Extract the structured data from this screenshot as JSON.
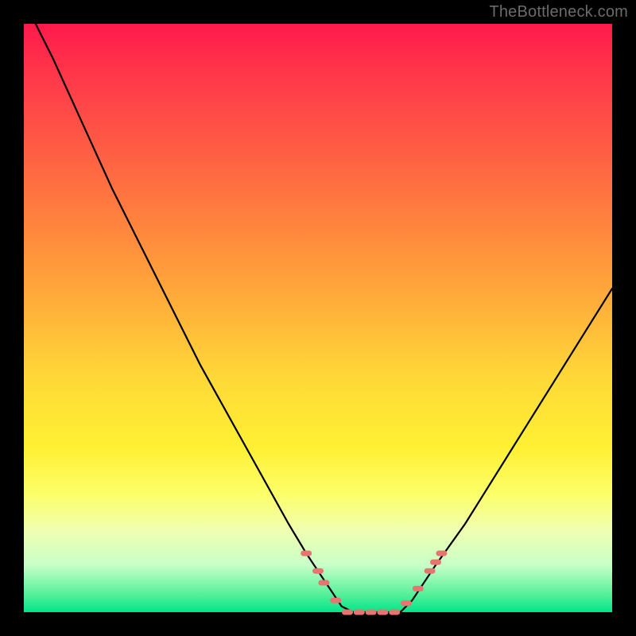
{
  "attribution": "TheBottleneck.com",
  "colors": {
    "frame": "#000000",
    "gradient_top": "#ff1a4b",
    "gradient_bottom": "#00e58a",
    "curve": "#000000",
    "marker": "#e6746f"
  },
  "chart_data": {
    "type": "line",
    "title": "",
    "xlabel": "",
    "ylabel": "",
    "xlim": [
      0,
      100
    ],
    "ylim": [
      0,
      100
    ],
    "grid": false,
    "legend": false,
    "series": [
      {
        "name": "bottleneck-curve",
        "x": [
          2,
          5,
          10,
          15,
          20,
          25,
          30,
          35,
          40,
          45,
          48,
          50,
          52,
          54,
          56,
          58,
          60,
          62,
          64,
          66,
          70,
          75,
          80,
          85,
          90,
          95,
          100
        ],
        "y": [
          100,
          94,
          83,
          72,
          62,
          52,
          42,
          33,
          24,
          15,
          10,
          7,
          4,
          1,
          0,
          0,
          0,
          0,
          0,
          2,
          8,
          15,
          23,
          31,
          39,
          47,
          55
        ]
      }
    ],
    "markers": [
      {
        "x": 48,
        "y": 10
      },
      {
        "x": 50,
        "y": 7
      },
      {
        "x": 51,
        "y": 5
      },
      {
        "x": 53,
        "y": 2
      },
      {
        "x": 55,
        "y": 0
      },
      {
        "x": 57,
        "y": 0
      },
      {
        "x": 59,
        "y": 0
      },
      {
        "x": 61,
        "y": 0
      },
      {
        "x": 63,
        "y": 0
      },
      {
        "x": 65,
        "y": 1.5
      },
      {
        "x": 67,
        "y": 4
      },
      {
        "x": 69,
        "y": 7
      },
      {
        "x": 70,
        "y": 8.5
      },
      {
        "x": 71,
        "y": 10
      }
    ]
  }
}
